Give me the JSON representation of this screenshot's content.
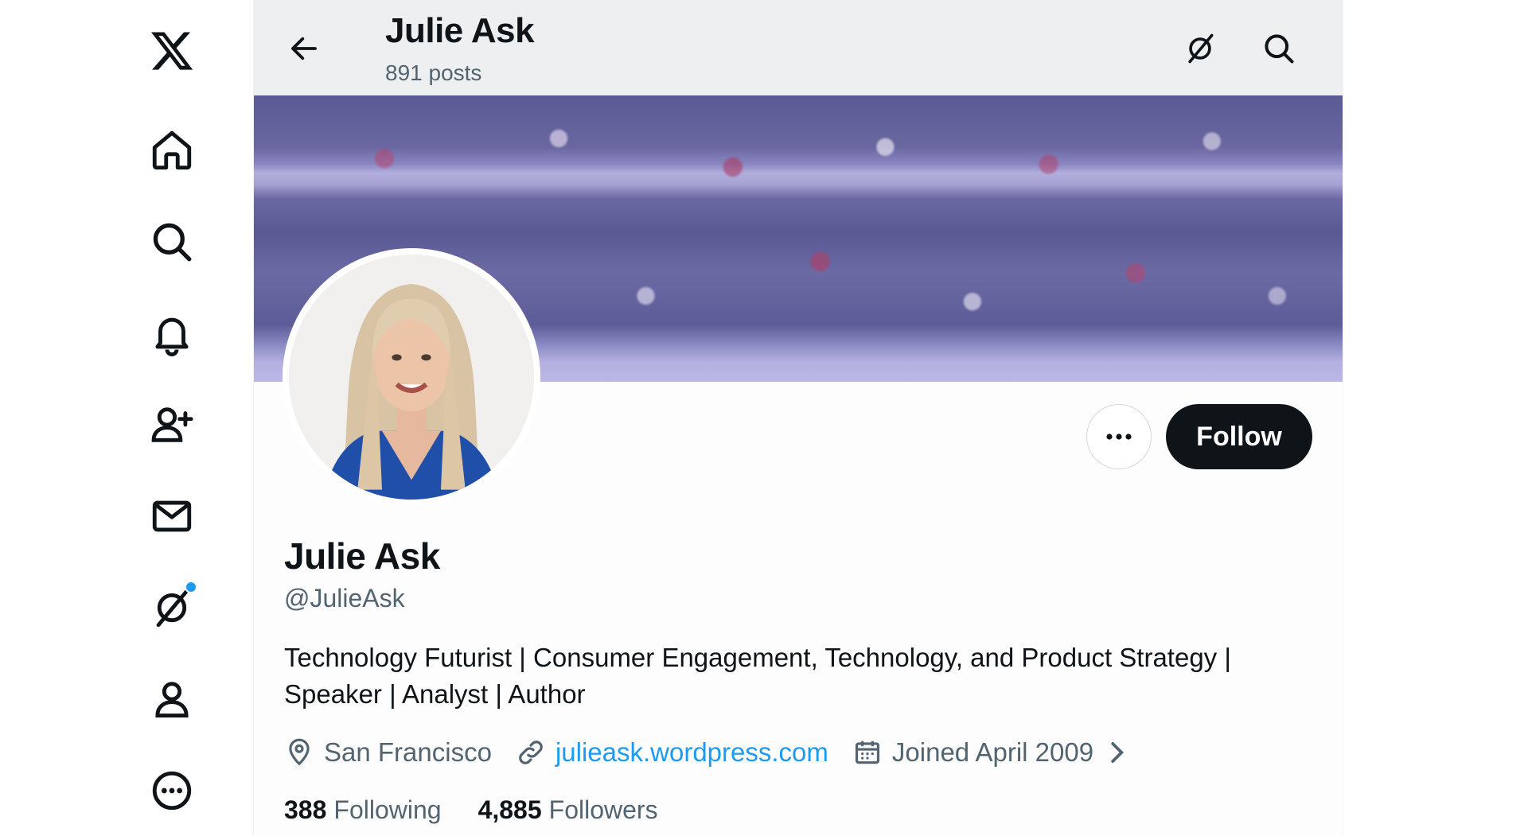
{
  "nav": {
    "items": [
      {
        "id": "logo",
        "icon": "x-logo-icon"
      },
      {
        "id": "home",
        "icon": "home-icon"
      },
      {
        "id": "explore",
        "icon": "search-icon"
      },
      {
        "id": "notifications",
        "icon": "bell-icon"
      },
      {
        "id": "follow",
        "icon": "person-add-icon"
      },
      {
        "id": "messages",
        "icon": "mail-icon"
      },
      {
        "id": "grok",
        "icon": "grok-icon",
        "badge": true
      },
      {
        "id": "profile",
        "icon": "person-icon"
      },
      {
        "id": "more",
        "icon": "more-circle-icon"
      }
    ],
    "badge_color": "#1d9bf0"
  },
  "header": {
    "title": "Julie Ask",
    "subtitle": "891 posts",
    "icons": [
      "back-arrow-icon",
      "grok-icon",
      "search-icon"
    ]
  },
  "profile": {
    "name": "Julie Ask",
    "handle": "@JulieAsk",
    "bio": "Technology Futurist | Consumer Engagement, Technology, and Product Strategy | Speaker | Analyst | Author",
    "location": "San Francisco",
    "website": "julieask.wordpress.com",
    "joined": "Joined April 2009",
    "following_count": "388",
    "following_label": "Following",
    "followers_count": "4,885",
    "followers_label": "Followers"
  },
  "actions": {
    "follow_label": "Follow"
  },
  "colors": {
    "accent": "#1d9bf0",
    "text": "#0f1419",
    "secondary": "#536471",
    "follow_bg": "#0f1419"
  }
}
